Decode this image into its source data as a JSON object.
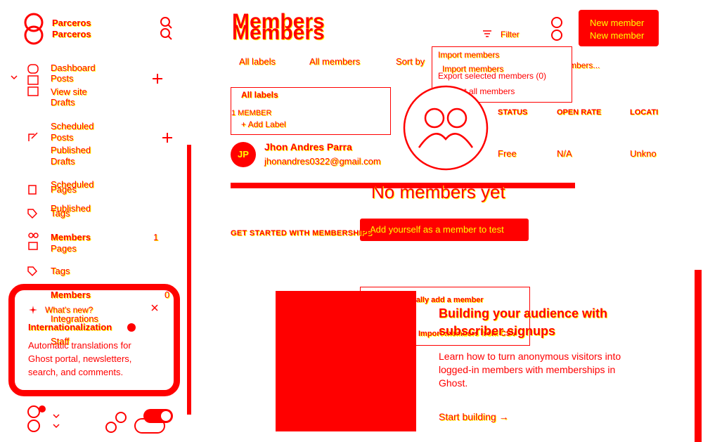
{
  "brand": {
    "name": "Parceros",
    "name_echo": "Parceros"
  },
  "sidebar": {
    "items": [
      {
        "label": "Dashboard"
      },
      {
        "label": "Posts"
      },
      {
        "label": "View site"
      },
      {
        "label": "Drafts"
      },
      {
        "label": "Scheduled"
      },
      {
        "label": "Posts"
      },
      {
        "label": "Published"
      },
      {
        "label": "Drafts"
      },
      {
        "label": "Scheduled"
      },
      {
        "label": "Pages"
      },
      {
        "label": "Published"
      },
      {
        "label": "Tags"
      },
      {
        "label": "Members",
        "count": "1"
      },
      {
        "label": "Pages"
      },
      {
        "label": "Tags"
      },
      {
        "label": "Members",
        "count": "0"
      },
      {
        "label": "Integrations"
      },
      {
        "label": "Staff"
      }
    ],
    "whats_new": {
      "heading": "What's new?",
      "title": "Internationalization",
      "body": "Automatic translations for Ghost portal, newsletters, search, and comments."
    }
  },
  "header": {
    "title": "Members",
    "title_echo": "Members",
    "filter_label": "Filter",
    "new_member_label": "New member",
    "new_member_echo": "New member"
  },
  "toolbar": {
    "all_labels": "All labels",
    "all_members": "All members",
    "sort_by": "Sort by",
    "search_members": "Search members..."
  },
  "dropdown": {
    "import": "Import members",
    "import_echo": "Import members",
    "export_selected": "Export selected members (0)",
    "export_all": "Export all members"
  },
  "label_popover": {
    "title": "All labels",
    "member_count": "1 MEMBER",
    "add_label": "+ Add Label"
  },
  "table": {
    "headers": [
      "STATUS",
      "OPEN RATE",
      "LOCATI"
    ],
    "rows": [
      {
        "initials": "JP",
        "name": "Jhon Andres Parra",
        "email": "jhonandres0322@gmail.com",
        "status": "Free",
        "open_rate": "N/A",
        "location": "Unkno"
      }
    ]
  },
  "empty_state": {
    "title": "No members yet",
    "add_yourself": "Add yourself as a member to test",
    "manually_add": "Manually add a member",
    "import_members": "Import members from CSV"
  },
  "getting_started": {
    "heading": "GET STARTED WITH MEMBERSHIPS",
    "card_title": "Building your audience with subscriber signups",
    "card_body": "Learn how to turn anonymous visitors into logged-in members with memberships in Ghost.",
    "card_link": "Start building →"
  },
  "colors": {
    "accent": "#ff0000",
    "secondary": "#ffff00",
    "background": "#ffffff"
  }
}
